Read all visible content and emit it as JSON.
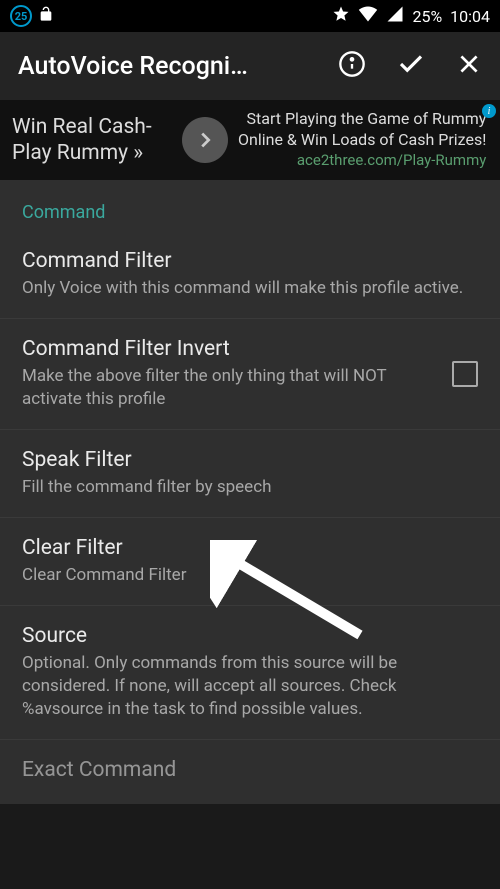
{
  "status": {
    "badge": "25",
    "battery": "25%",
    "time": "10:04"
  },
  "appbar": {
    "title": "AutoVoice Recogni…"
  },
  "ad": {
    "left_line1": "Win Real Cash-",
    "left_line2": "Play Rummy »",
    "right_line1": "Start Playing the Game of Rummy",
    "right_line2": "Online & Win Loads of Cash Prizes!",
    "url": "ace2three.com/Play-Rummy"
  },
  "section": {
    "header": "Command"
  },
  "items": {
    "filter": {
      "title": "Command Filter",
      "sub": "Only Voice with this command will make this profile active."
    },
    "invert": {
      "title": "Command Filter Invert",
      "sub": "Make the above filter the only thing that will NOT activate this profile"
    },
    "speak": {
      "title": "Speak Filter",
      "sub": "Fill the command filter by speech"
    },
    "clear": {
      "title": "Clear Filter",
      "sub": "Clear Command Filter"
    },
    "source": {
      "title": "Source",
      "sub": "Optional. Only commands from this source will be considered. If none, will accept all sources. Check %avsource in the task to find possible values."
    },
    "exact": {
      "title": "Exact Command"
    }
  }
}
